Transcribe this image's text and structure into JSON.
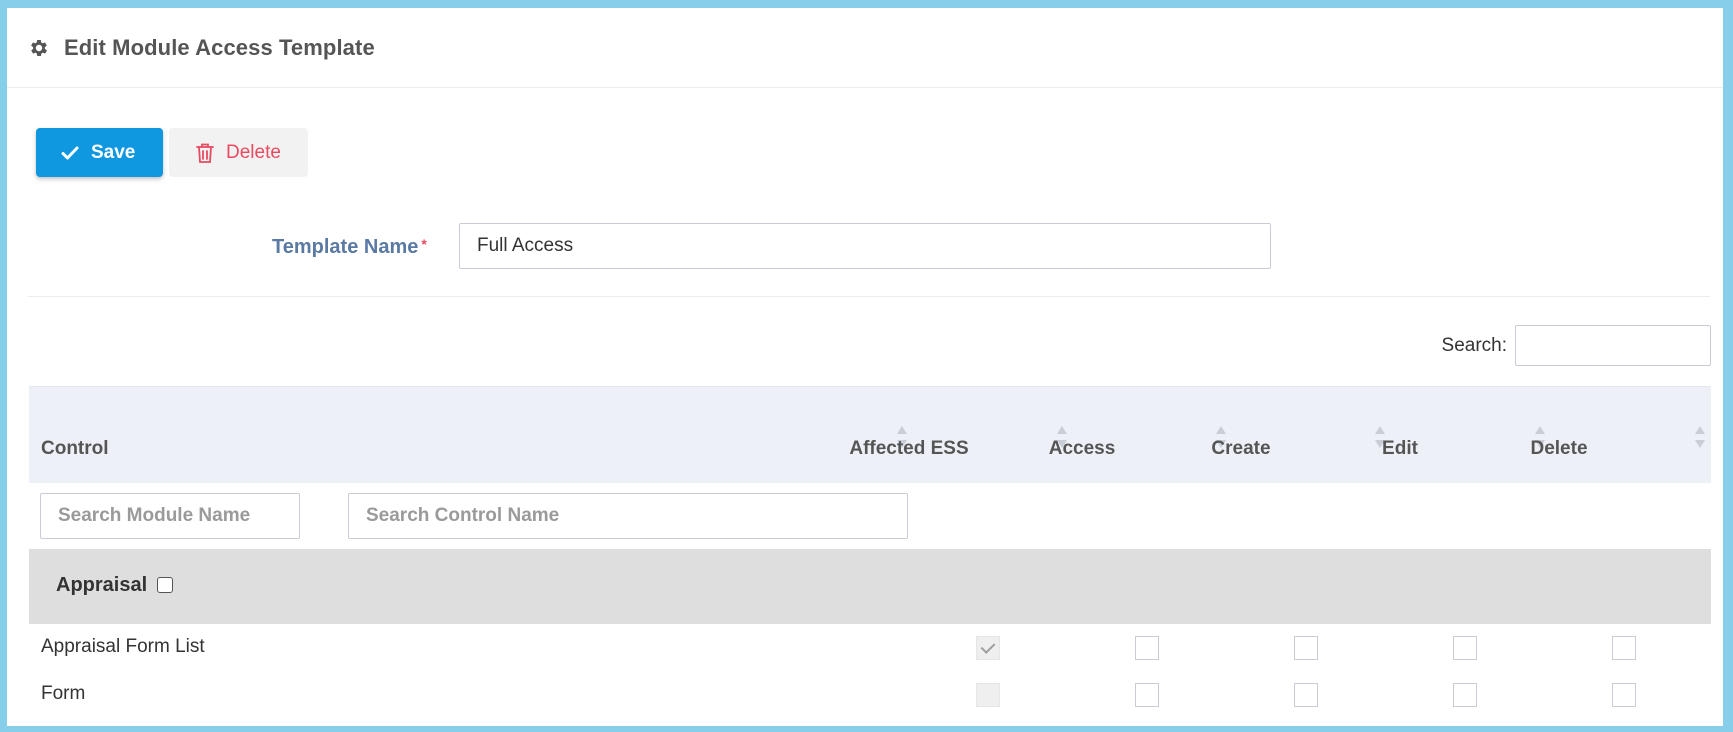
{
  "header": {
    "title": "Edit Module Access Template",
    "icon": "gear-icon"
  },
  "toolbar": {
    "save_label": "Save",
    "delete_label": "Delete"
  },
  "form": {
    "template_name_label": "Template Name",
    "required_mark": "*",
    "template_name_value": "Full Access"
  },
  "search": {
    "label": "Search:",
    "value": ""
  },
  "table": {
    "columns": [
      "Control",
      "Affected ESS",
      "Access",
      "Create",
      "Edit",
      "Delete"
    ],
    "filters": {
      "module_placeholder": "Search Module Name",
      "control_placeholder": "Search Control Name"
    },
    "groups": [
      {
        "name": "Appraisal",
        "rows": [
          {
            "control": "Appraisal Form List",
            "affected_ess": true
          },
          {
            "control": "Form",
            "affected_ess": false
          }
        ]
      }
    ]
  },
  "colors": {
    "save_button": "#0f97e0",
    "delete_text": "#e84a5f",
    "frame_border": "#87ceeb",
    "header_bg": "#edf1f7",
    "group_bg": "#dedede"
  }
}
